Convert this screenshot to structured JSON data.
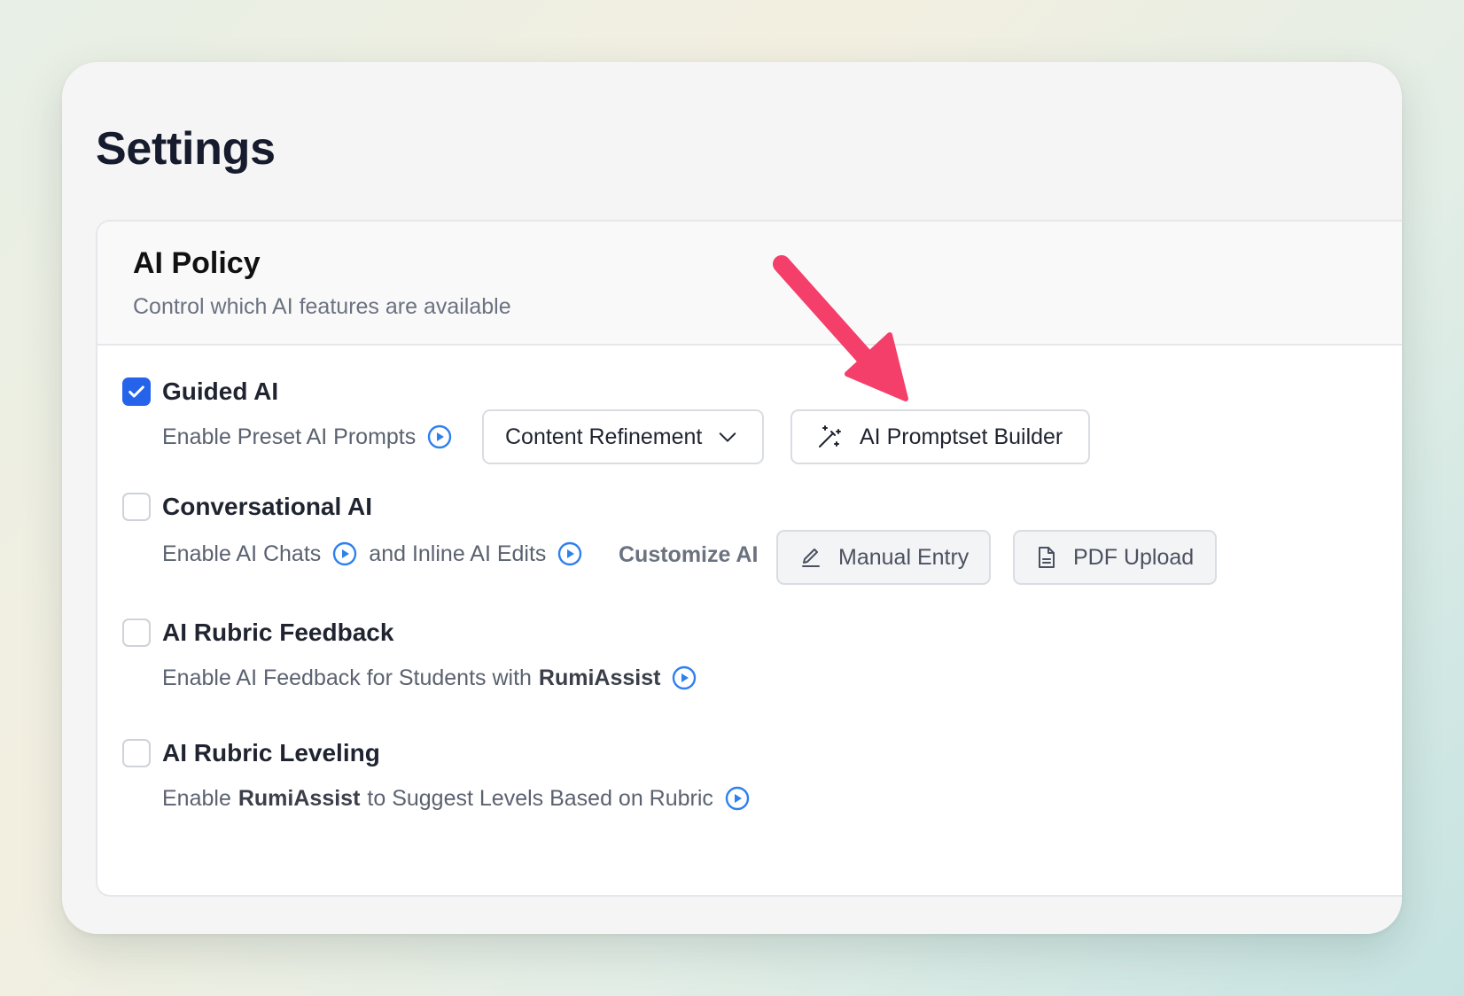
{
  "page": {
    "title": "Settings"
  },
  "panel": {
    "title": "AI Policy",
    "subtitle": "Control which AI features are available"
  },
  "options": {
    "guided_ai": {
      "title": "Guided AI",
      "checked": true,
      "desc": "Enable Preset AI Prompts",
      "dropdown_value": "Content Refinement",
      "builder_label": "AI Promptset Builder"
    },
    "conversational_ai": {
      "title": "Conversational AI",
      "checked": false,
      "desc_part1": "Enable AI Chats",
      "desc_part2": "and Inline AI Edits",
      "customize_label": "Customize AI",
      "manual_entry_label": "Manual Entry",
      "pdf_upload_label": "PDF Upload"
    },
    "rubric_feedback": {
      "title": "AI Rubric Feedback",
      "checked": false,
      "desc_prefix": "Enable AI Feedback for Students with",
      "desc_brand": "RumiAssist"
    },
    "rubric_leveling": {
      "title": "AI Rubric Leveling",
      "checked": false,
      "desc_prefix": "Enable",
      "desc_brand": "RumiAssist",
      "desc_suffix": "to Suggest Levels Based on Rubric"
    }
  },
  "icons": {
    "play": "play-circle-icon",
    "chevron": "chevron-down-icon",
    "wand": "magic-wand-icon",
    "pencil": "pencil-icon",
    "file": "file-icon",
    "check": "checkmark-icon",
    "annotation_arrow": "arrow-icon"
  },
  "colors": {
    "accent": "#2563eb",
    "annotation_arrow": "#f43f6b"
  }
}
